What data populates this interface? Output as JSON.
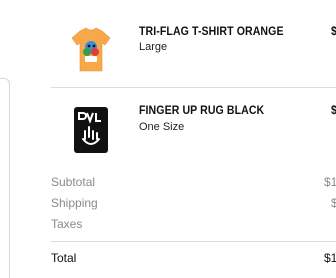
{
  "cart": {
    "items": [
      {
        "name": "TRI-FLAG T-SHIRT ORANGE",
        "variant": "Large",
        "price": "$",
        "thumb_icon": "orange-tshirt-icon",
        "thumb_color": "#f7a94a"
      },
      {
        "name": "FINGER UP RUG BLACK",
        "variant": "One Size",
        "price": "$",
        "thumb_icon": "black-rug-icon",
        "thumb_color": "#111111"
      }
    ]
  },
  "summary": {
    "lines": [
      {
        "label": "Subtotal",
        "value": "$1"
      },
      {
        "label": "Shipping",
        "value": "$"
      },
      {
        "label": "Taxes",
        "value": ""
      }
    ],
    "total_label": "Total",
    "total_value": "$1"
  },
  "colors": {
    "muted_text": "#8a8a8a",
    "divider": "#dedede"
  }
}
